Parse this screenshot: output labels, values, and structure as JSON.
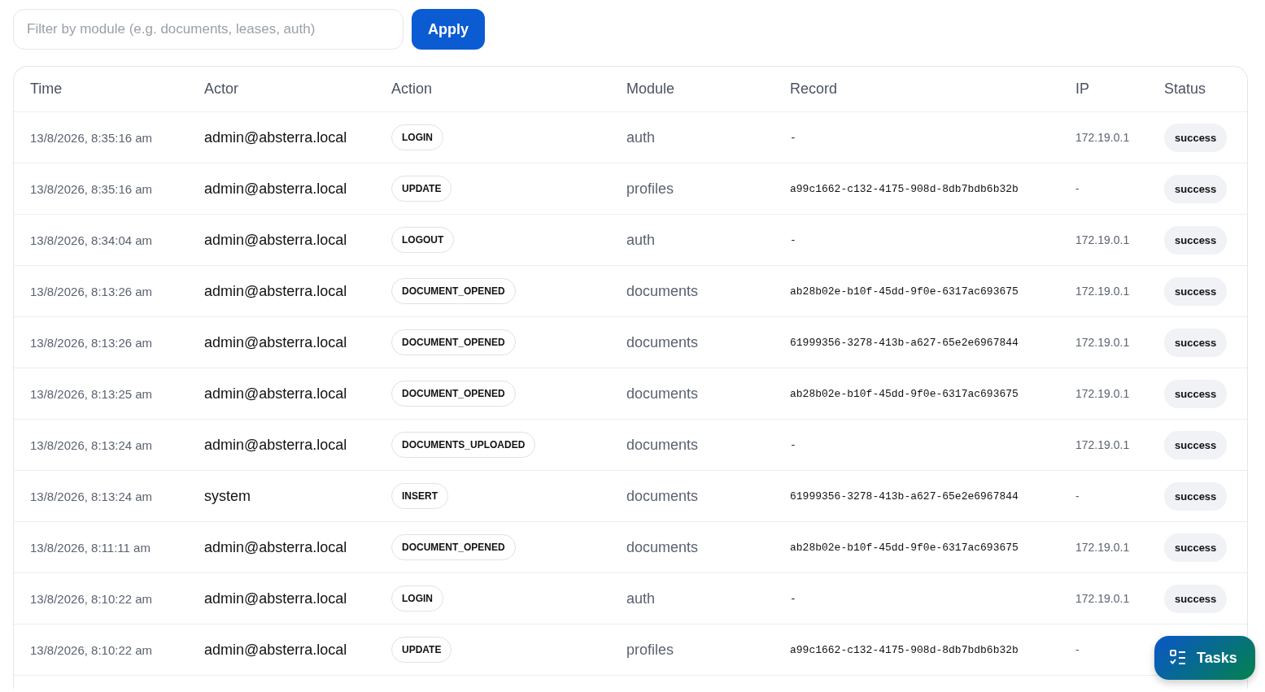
{
  "filter": {
    "placeholder": "Filter by module (e.g. documents, leases, auth)",
    "button": "Apply"
  },
  "table": {
    "columns": [
      "Time",
      "Actor",
      "Action",
      "Module",
      "Record",
      "IP",
      "Status"
    ],
    "rows": [
      {
        "time": "13/8/2026, 8:35:16 am",
        "actor": "admin@absterra.local",
        "action": "LOGIN",
        "module": "auth",
        "record": "-",
        "ip": "172.19.0.1",
        "status": "success"
      },
      {
        "time": "13/8/2026, 8:35:16 am",
        "actor": "admin@absterra.local",
        "action": "UPDATE",
        "module": "profiles",
        "record": "a99c1662-c132-4175-908d-8db7bdb6b32b",
        "ip": "-",
        "status": "success"
      },
      {
        "time": "13/8/2026, 8:34:04 am",
        "actor": "admin@absterra.local",
        "action": "LOGOUT",
        "module": "auth",
        "record": "-",
        "ip": "172.19.0.1",
        "status": "success"
      },
      {
        "time": "13/8/2026, 8:13:26 am",
        "actor": "admin@absterra.local",
        "action": "DOCUMENT_OPENED",
        "module": "documents",
        "record": "ab28b02e-b10f-45dd-9f0e-6317ac693675",
        "ip": "172.19.0.1",
        "status": "success"
      },
      {
        "time": "13/8/2026, 8:13:26 am",
        "actor": "admin@absterra.local",
        "action": "DOCUMENT_OPENED",
        "module": "documents",
        "record": "61999356-3278-413b-a627-65e2e6967844",
        "ip": "172.19.0.1",
        "status": "success"
      },
      {
        "time": "13/8/2026, 8:13:25 am",
        "actor": "admin@absterra.local",
        "action": "DOCUMENT_OPENED",
        "module": "documents",
        "record": "ab28b02e-b10f-45dd-9f0e-6317ac693675",
        "ip": "172.19.0.1",
        "status": "success"
      },
      {
        "time": "13/8/2026, 8:13:24 am",
        "actor": "admin@absterra.local",
        "action": "DOCUMENTS_UPLOADED",
        "module": "documents",
        "record": "-",
        "ip": "172.19.0.1",
        "status": "success"
      },
      {
        "time": "13/8/2026, 8:13:24 am",
        "actor": "system",
        "action": "INSERT",
        "module": "documents",
        "record": "61999356-3278-413b-a627-65e2e6967844",
        "ip": "-",
        "status": "success"
      },
      {
        "time": "13/8/2026, 8:11:11 am",
        "actor": "admin@absterra.local",
        "action": "DOCUMENT_OPENED",
        "module": "documents",
        "record": "ab28b02e-b10f-45dd-9f0e-6317ac693675",
        "ip": "172.19.0.1",
        "status": "success"
      },
      {
        "time": "13/8/2026, 8:10:22 am",
        "actor": "admin@absterra.local",
        "action": "LOGIN",
        "module": "auth",
        "record": "-",
        "ip": "172.19.0.1",
        "status": "success"
      },
      {
        "time": "13/8/2026, 8:10:22 am",
        "actor": "admin@absterra.local",
        "action": "UPDATE",
        "module": "profiles",
        "record": "a99c1662-c132-4175-908d-8db7bdb6b32b",
        "ip": "-"
      }
    ]
  },
  "tasks_button": {
    "label": "Tasks"
  }
}
